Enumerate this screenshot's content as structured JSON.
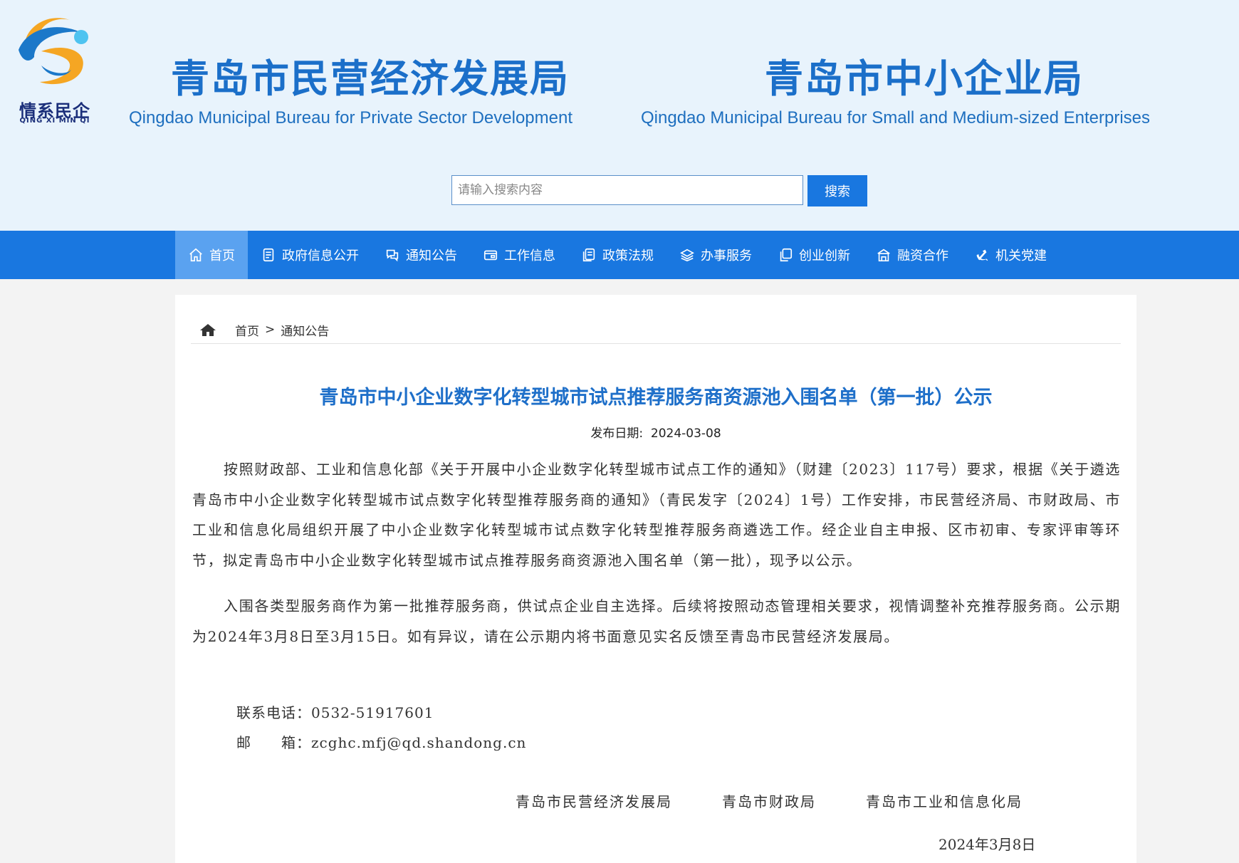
{
  "logo": {
    "cn": "情系民企",
    "en": "QING XI MIN QI"
  },
  "header": {
    "org1_cn": "青岛市民营经济发展局",
    "org1_en": "Qingdao Municipal Bureau for Private Sector Development",
    "org2_cn": "青岛市中小企业局",
    "org2_en": "Qingdao Municipal Bureau for Small and Medium-sized Enterprises"
  },
  "search": {
    "placeholder": "请输入搜索内容",
    "value": "",
    "button_label": "搜索"
  },
  "nav": {
    "items": [
      {
        "label": "首页",
        "icon": "home-icon"
      },
      {
        "label": "政府信息公开",
        "icon": "document-list-icon"
      },
      {
        "label": "通知公告",
        "icon": "chat-bubbles-icon"
      },
      {
        "label": "工作信息",
        "icon": "id-card-icon"
      },
      {
        "label": "政策法规",
        "icon": "files-icon"
      },
      {
        "label": "办事服务",
        "icon": "layers-icon"
      },
      {
        "label": "创业创新",
        "icon": "copy-icon"
      },
      {
        "label": "融资合作",
        "icon": "building-icon"
      },
      {
        "label": "机关党建",
        "icon": "party-emblem-icon"
      }
    ]
  },
  "breadcrumb": {
    "home": "首页",
    "separator": ">",
    "current": "通知公告"
  },
  "article": {
    "title": "青岛市中小企业数字化转型城市试点推荐服务商资源池入围名单（第一批）公示",
    "date_label": "发布日期:",
    "date_value": "2024-03-08",
    "paragraphs": [
      "按照财政部、工业和信息化部《关于开展中小企业数字化转型城市试点工作的通知》（财建〔2023〕117号）要求，根据《关于遴选青岛市中小企业数字化转型城市试点数字化转型推荐服务商的通知》（青民发字〔2024〕1号）工作安排，市民营经济局、市财政局、市工业和信息化局组织开展了中小企业数字化转型城市试点数字化转型推荐服务商遴选工作。经企业自主申报、区市初审、专家评审等环节，拟定青岛市中小企业数字化转型城市试点推荐服务商资源池入围名单（第一批），现予以公示。",
      "入围各类型服务商作为第一批推荐服务商，供试点企业自主选择。后续将按照动态管理相关要求，视情调整补充推荐服务商。公示期为2024年3月8日至3月15日。如有异议，请在公示期内将书面意见实名反馈至青岛市民营经济发展局。"
    ],
    "contact_phone_label": "联系电话：",
    "contact_phone": "0532-51917601",
    "contact_email_label": "邮　　箱：",
    "contact_email": "zcghc.mfj@qd.shandong.cn",
    "signers": [
      "青岛市民营经济发展局",
      "青岛市财政局",
      "青岛市工业和信息化局"
    ],
    "sign_date": "2024年3月8日"
  },
  "colors": {
    "brand_blue": "#1977e0",
    "title_blue": "#1e6fc9",
    "header_bg": "#e8f3fc",
    "nav_active": "#5aa2f0"
  }
}
